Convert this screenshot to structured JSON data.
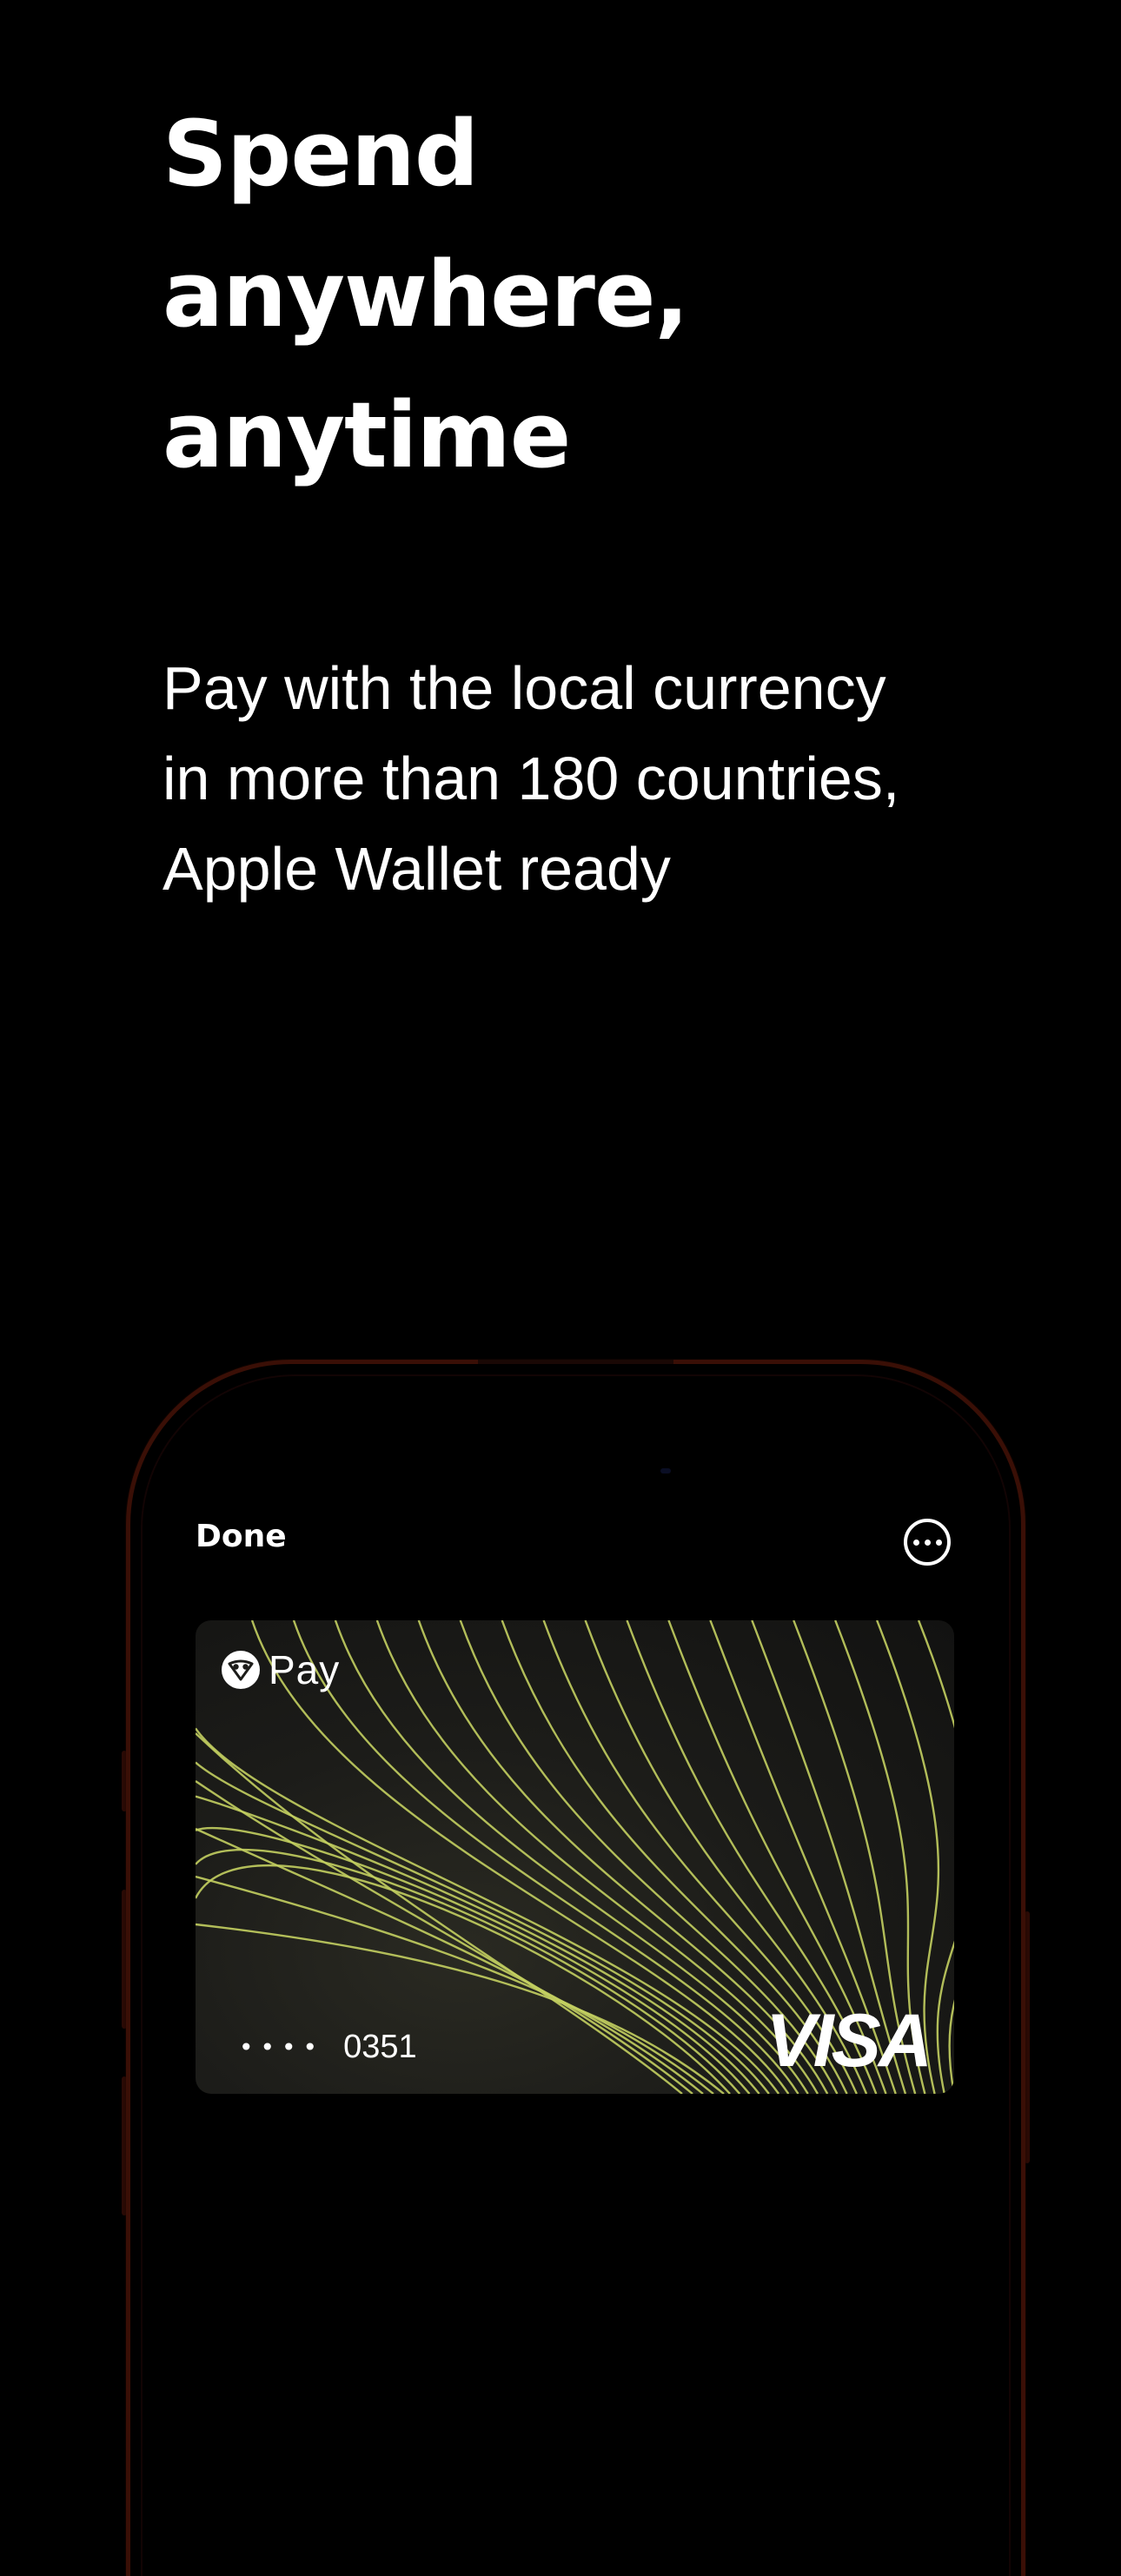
{
  "headline": {
    "line1": "Spend",
    "line2": "anywhere,",
    "line3": "anytime"
  },
  "subtitle": {
    "line1": "Pay with the local currency",
    "line2": "in more than 180 countries,",
    "line3": "Apple Wallet ready"
  },
  "wallet": {
    "done_label": "Done",
    "more_icon": "ellipsis-circle-icon"
  },
  "card": {
    "brand_icon": "owl-logo-icon",
    "brand_label": "Pay",
    "number_mask": "••••",
    "last4": "0351",
    "network": "VISA",
    "line_color": "#c3cf60",
    "background_color": "#1c1c19"
  },
  "colors": {
    "background": "#000000",
    "text": "#ffffff",
    "phone_frame": "#3a0f06"
  }
}
